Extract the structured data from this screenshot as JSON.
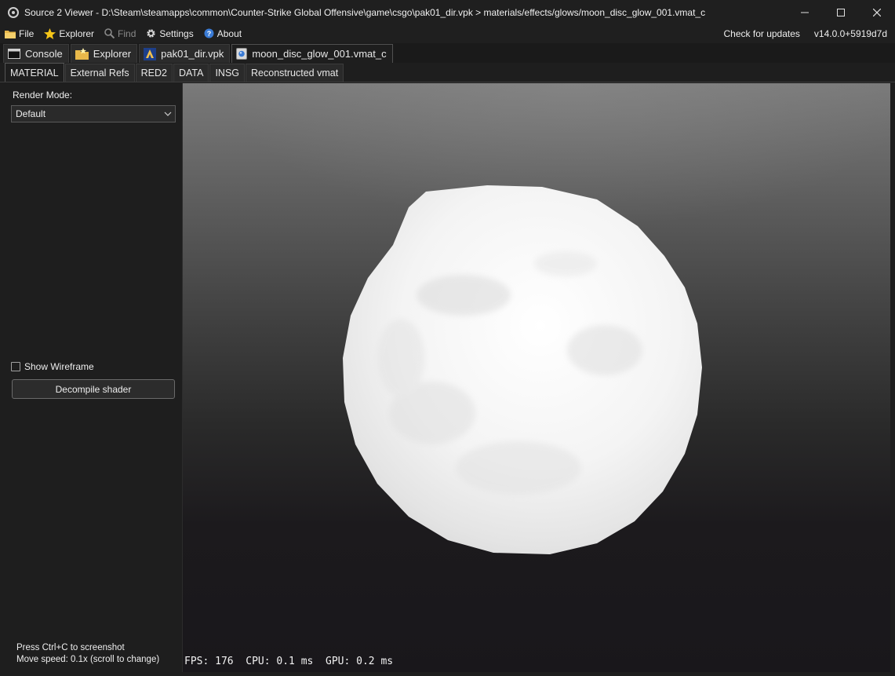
{
  "window": {
    "title": "Source 2 Viewer - D:\\Steam\\steamapps\\common\\Counter-Strike Global Offensive\\game\\csgo\\pak01_dir.vpk > materials/effects/glows/moon_disc_glow_001.vmat_c"
  },
  "menu": {
    "file": "File",
    "explorer": "Explorer",
    "find": "Find",
    "settings": "Settings",
    "about": "About",
    "check_updates": "Check for updates",
    "version": "v14.0.0+5919d7d"
  },
  "file_tabs": [
    {
      "label": "Console",
      "icon": "console-icon"
    },
    {
      "label": "Explorer",
      "icon": "folder-icon"
    },
    {
      "label": "pak01_dir.vpk",
      "icon": "vpk-icon"
    },
    {
      "label": "moon_disc_glow_001.vmat_c",
      "icon": "material-icon",
      "active": true
    }
  ],
  "sub_tabs": [
    {
      "label": "MATERIAL",
      "active": true
    },
    {
      "label": "External Refs"
    },
    {
      "label": "RED2"
    },
    {
      "label": "DATA"
    },
    {
      "label": "INSG"
    },
    {
      "label": "Reconstructed vmat"
    }
  ],
  "sidebar": {
    "render_mode_label": "Render Mode:",
    "render_mode_value": "Default",
    "show_wireframe": "Show Wireframe",
    "show_wireframe_checked": false,
    "decompile": "Decompile shader",
    "hint_screenshot": "Press Ctrl+C to screenshot",
    "hint_speed": "Move speed: 0.1x (scroll to change)"
  },
  "viewport": {
    "stats": "FPS: 176  CPU: 0.1 ms  GPU: 0.2 ms"
  },
  "colors": {
    "window_bg": "#1e1e1e",
    "tab_bg": "#2b2b2b",
    "accent_star": "#f5c518",
    "accent_about": "#3a7bd5"
  }
}
